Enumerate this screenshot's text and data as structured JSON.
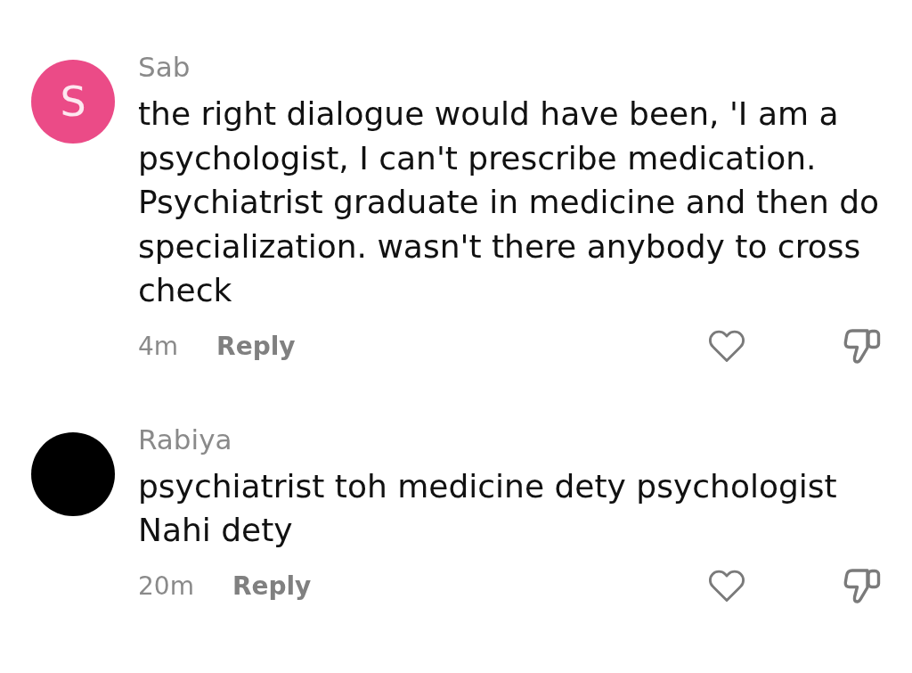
{
  "comments": [
    {
      "avatar": {
        "letter": "S",
        "color": "#eb4b87"
      },
      "author": "Sab",
      "text": "the right dialogue would have been, 'I am a psychologist, I can't prescribe medication. Psychiatrist graduate in medicine and then do specialization. wasn't there anybody to cross check",
      "time": "4m",
      "reply_label": "Reply"
    },
    {
      "avatar": {
        "color": "#000000"
      },
      "author": "Rabiya",
      "text": "psychiatrist toh medicine dety psychologist Nahi dety",
      "time": "20m",
      "reply_label": "Reply"
    }
  ]
}
